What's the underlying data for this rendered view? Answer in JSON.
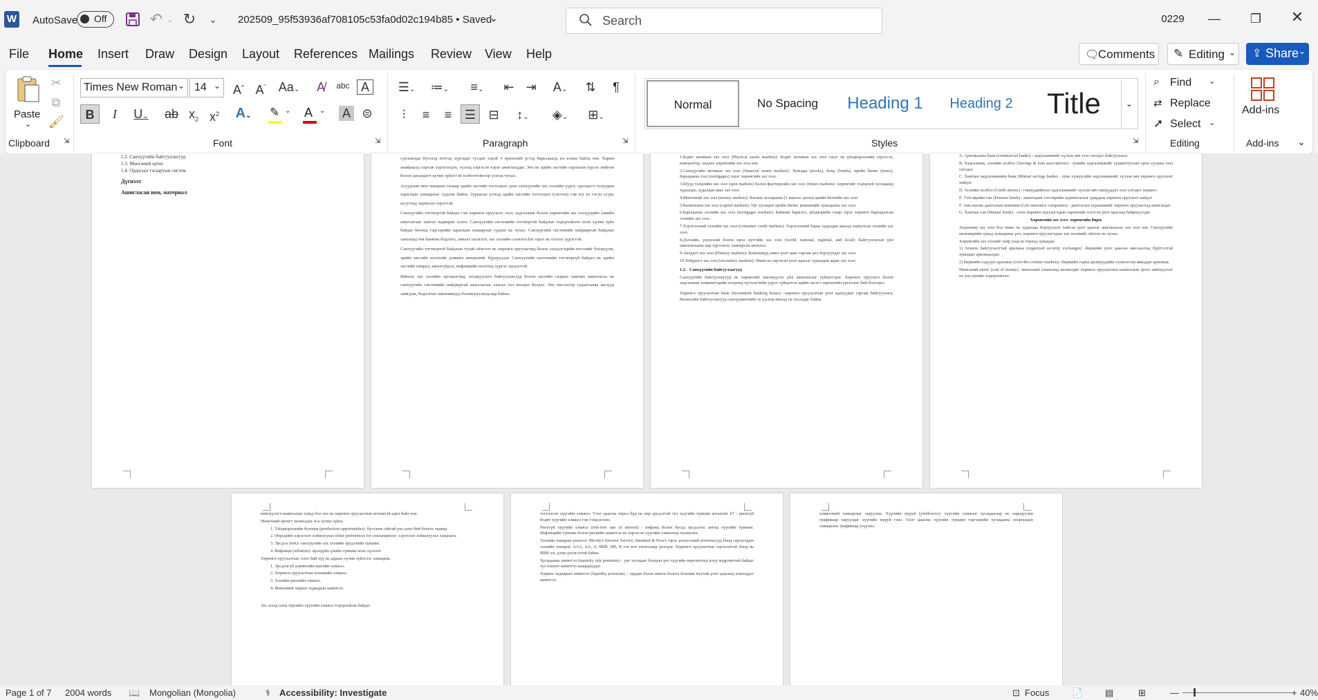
{
  "titlebar": {
    "autosave_label": "AutoSave",
    "autosave_state": "Off",
    "doc_title": "202509_95f53936af708105c53fa0d02c194b85 • Saved",
    "search_placeholder": "Search",
    "user_initials": "0229"
  },
  "menu": {
    "tabs": [
      "File",
      "Home",
      "Insert",
      "Draw",
      "Design",
      "Layout",
      "References",
      "Mailings",
      "Review",
      "View",
      "Help"
    ],
    "active": "Home",
    "comments_label": "Comments",
    "editing_label": "Editing",
    "share_label": "Share"
  },
  "ribbon": {
    "clipboard": {
      "paste_label": "Paste",
      "group_label": "Clipboard"
    },
    "font": {
      "font_name": "Times New Roman",
      "font_size": "14",
      "group_label": "Font"
    },
    "paragraph": {
      "group_label": "Paragraph"
    },
    "styles": {
      "items": [
        "Normal",
        "No Spacing",
        "Heading 1",
        "Heading 2",
        "Title"
      ],
      "group_label": "Styles"
    },
    "editing": {
      "find": "Find",
      "replace": "Replace",
      "select": "Select",
      "group_label": "Editing"
    },
    "addins": {
      "label": "Add-ins",
      "group_label": "Add-ins"
    }
  },
  "pages": {
    "p1": {
      "lines": [
        "1.2. Санхүүгийн байгууллагууд",
        "1.3. Мөнгөний өртөг",
        "1.4. Ордогын тэгааруын систем"
      ],
      "heading1": "Дүгнэлт",
      "heading2": "Ашигласан ном, материал"
    },
    "p2": {
      "paragraphs": [
        "сурлаагдаа бүтэлэд итлтэд хүргадат тусдан хэдэй ч өрнөсний үгтэд барьсааалд их клана байла юм. Харин анайраалд хэрхэж хэрэглэгдэх, түзлэд хэргэсэн хэрэг ажиглагддаг. Энэ нь эдийн засгийн гарлагын хүрээг нийгэм болон дагалдагч хүчин зүйлстэй холбоотойгоор үзэхэд чухал.",
        "Асуудлын мөн чанарын талаар эдийн засгийн тогтолцоо дахь санхүүгийн зах зээлийн үүрэг, оролцогч талуудын харилцан хамаарлыг судалж байна. Зураасан үзэхэд эдийн засгийн тогтолцоо (систем) гэж юу вэ гэсэн суурь асуултад хариулах хэрэгтэй.",
        "Санхүүгийн тогтвортой байдал гэж хөрөнгө оруулалт, зээл, хадгаламж болон хөрөнгийн зах зээлүүдийн хэвийн ажиллагааг хангах чадварыг хэлнэ. Санхүүгийн системийн тогтвортой байдлыг тодорхойлох олон хүчин зүйл байдаг бөгөөд тэдгээрийн харилцан хамаарлыг судлах нь чухал. Санхүүгийн системийн найдвартай байдлыг хангахад төв банкны бодлого, хяналт шалгалт, зах зээлийн сахилга бат зэрэг нь голлох үүрэгтэй.",
        "Санхүүгийн тогтвортой байдлын тухай ойлголт нь хөрөнгө оруулагчид болон зээлдэгчдийн итгэлийг бэхжүүлж, эдийн засгийн өсөлтийг дэмжих нөхцөлийг бүрдүүлдэг. Санхүүгийн системийн тогтворгүй байдал нь эдийн засгийн хямрал, ажилгүйдэл, инфляцийн өсөлтөд хүргэх эрсдэлтэй.",
        "Иймээс зах зээлийн оролцогчид, зохицуулагч байгууллагууд болон засгийн газрын хамтын ажиллагаа нь санхүүгийн системийн найдвартай ажиллагааг хангах гол нөхцөл болдог. Энэ чиглэлээр судалгааны ажлууд хийгдэж, бодлогын зөвлөмжүүд боловсруулагдсаар байна."
      ]
    },
    "p3": {
      "list": [
        "1.Бодит активын зах зээл (Physical assets markets): Бодит активын зах зээл гэдэг нь үйлдвэрлэлийн хэрэгсэл, компьютер, хөдлөх хөрөнгийн зах зээл юм.",
        "2.Санхүүгийн активын зах зээл (financial assets markets): Хувьцаа (stocks), бонд (bonds), өрийн бичиг (notes), барьцааны зээл (mortgages) зэрэг хөрөнгийн зах зээл.",
        "3.Шууд хэлцлийн зах зээл (spot markets) болон фьючерсийн зах зээл (future markets): хөрөнгийг тодорхой хугацаанд худалдах, худалдан авах зах зээл.",
        "4.Мөнгөний зах зээл (money markets): Богино хугацааны (1 жилээс доош) өрийн бичгийн зах зээл.",
        "5.Капиталын зах зээл (capital markets): Урт хугацаат өрийн бичиг, компанийн хувьцааны зах зээл.",
        "6.Барьцааны зээлийн зах зээл (mortgages markets): Байшин барилга, үйлдвэрийн газар зэрэг хөрөнгө барьцаалсан зээлийн зах зээл.",
        "7.Хэрэглээний зээлийн зах зээл (consumer credit markets): Хэрэглээний бараа худалдан авахад зориулсан зээлийн зах зээл.",
        "8.Дэлхийн, үндэсний болон орон нутгийн зах зээл (world, national, regional, and local): Байгууллагын үйл ажиллагааны цар хүрээнээс хамаарсан ангилал.",
        "9.Анхдагч зах зээл (Primary markets): Компаниуд шинэ үнэт цаас гаргаж анх борлуулдаг зах зээл.",
        "10.Хоёрдогч зах зээл (secondary markets): Өмнө нь гаргасан үнэт цаасыг худалдаж авдаг зах зээл."
      ],
      "section_num": "1.2.",
      "section_title": "Санхүүгийн байгууллагууд",
      "paragraphs": [
        "Санхүүгийн байгууллагууд нь хөрөнгийг шилжүүлэх үйл ажиллагааг гүйцэтгэдэг. Хөрөнгө оруулагч болон хадгаламж эзэмшигчдийн хооронд зуучлагчийн үүрэг гүйцэтгэн эдийн засагт хөрөнгийн урсгалыг бий болгодог.",
        "Хөрөнгө оруулалтын банк (investment banking house) –хөрөнгө оруулалтын үнэт цаасуудыг гаргаж байгууллага, бизнесийн байгууллагууд санхүүжилтийн эх үүсвэр авахад нь тусалдаг байна."
      ]
    },
    "p4": {
      "list": [
        "А. Арилжааны банк (commercial banks) - хадгаламжийг хүлээн авч зээл олгодог байгууллага.",
        "B. Хадгаламж, зээлийн холбоо (Savings & loan associations) - хувийн хадгаламжийг хуримтлуулан орон сууцны зээл олгодог.",
        "C. Хамтын хадгаламжийн банк (Mutual savings banks) - хувь хүмүүсийн хадгаламжийг хүлээн авч хөрөнгө оруулалт хийдэг.",
        "D. Зээлийн холбоо (Credit unions) - гишүүдийнхээ хадгаламжийг хүлээн авч гишүүддээ зээл олгодог хоршоо.",
        "E. Тэтгэврийн сан (Pension funds) - ажилчдын тэтгэврийн хуримтлалыг удирдаж хөрөнгө оруулалт хийдэг.",
        "F. Амь насны даатгалын компани (Life insurance companies) - даатгалын хураамжийг хөрөнгө оруулалтад ашигладаг.",
        "G. Хамтын сан (Mutual funds) - олон хөрөнгө оруулагчдын хөрөнгийг нэгтгэн үнэт цаасанд байршуулдаг."
      ],
      "section_title": "Хөрөнгийн зах зээл- хөрөнгийн бирж",
      "paragraphs": [
        "Хөдөлмөр зах зээл бол өмнө нь худалдаа борлуулалт хийсэн үнэт цаасыг арилжаалах зах зээл юм. Санхүүгийн менежерийн хувьд хувьцааны үнэ, хөрөнгө оруулагчдын зан төлөвийг ойлгох нь чухал.",
        "Хөрөнгийн зах зээлийг хоёр үндсэн төрөлд хуваадаг."
      ],
      "numbered": [
        "1) Зохион байгуулалттай арилжаа (organized security exchanges) -биржийн үнэт цаасны жагсаалтад бүртгэлтэй хувьцааг арилжаалдаг.",
        "2) Биржийн гадуурх арилжаа (over-the-counter markets) -биржийн гадна дилерүүдийн сүлжээгээр явагддаг арилжаа."
      ],
      "closing": "Мөнгөний өртөг (cost of money) –мөнгөний хэмжээнд нөлөөлдөг хөрөнгө оруулалтын капиталын эрэлт нийлүүлэлт нь үнэ цэнийг тодорхойлно."
    },
    "p5": {
      "paragraphs": [
        "нийлүүлэгч капиталын хувьд бол энэ нь хөрөнгө оруулалтын өгөөжтэй адил байх юм.",
        "Мөнгөний өртөгт нөлөөлдөг 4-н хүчин зүйлс."
      ],
      "list": [
        "1. Үйлдвэрлэлийн боломж (production opportunities)- бүтээмж сайтай үнэ цэнэ бий болгох чадвар.",
        "2. Өөрсдийн хэрэглээг хойшлуулах (time preferences for consumption)- хэрэглээг хойшлуулах хандлага.",
        "3. Эрсдэл (risk)- санхүүгийн зах зээлийн эрсдэлийн түвшин.",
        "4. Инфляци (inflation)- ирээдүйн үнийн түвшин өсөх хүлээлт."
      ],
      "para2": "Хөрөнгө оруулалтаас олох бий хүү нь дараах хүчин зүйлсээс хамаарна.",
      "list2": [
        "1. Эрсдэлгүй хөрөнгийн ашгийн хэмжээ.",
        "2. Хөрөнгө оруулалтын өгөөжийн хэмжээ.",
        "3. Зээлийн рискийн хэмжээ.",
        "4. Мөнгөний хөрвөх чадварын шимтгэл."
      ],
      "closing": "Зах зээлд олон төрлийн хүүгийн хэмжээ тодорхойлж байдаг."
    },
    "p6": {
      "paragraphs": [
        "тогтоосон хүүгийн хэмжээ. Үнэт цаасны төрөл бүр нь өөр эрсдэлтэй тул хүүгийн түвшин ялгаатай. k* - рискгүй бодит хүүгийн хэмжээ гэж тэмдэглэнэ.",
        "Рискгүй хүүгийн хэмжээ (risk-free rate of interest) - инфляц болон бусад эрсдэлээс ангид хүүгийн түвшин. Инфляцийн түвшин болон рискийн шимтгэл нь нэрлэсэн хүүгийн хэмжээнд нөлөөлнө.",
        "Зээлийн чанарын үнэлгээ: Moody's Investor Service, Standard & Poor's зэрэг үнэлгээний агентлагууд бонд гаргагчдын зээлийн чанарыг AAA, AA, A, BBB, BB, B гэх мэт ангиллаар үнэлдэг. Хөрөнгө оруулалтын зэрэглэлтэй бонд нь BBB-ээс дээш үнэлгээтэй байна.",
        "Хугацааны шимтгэл (maturity risk premium) – урт хугацаат бондын үнэ хүүгийн өөрчлөлтөд илүү мэдрэмтгий байдаг тул нэмэлт шимтгэл шаардагддаг.",
        "Хөрвөх чадварын шимтгэл (liquidity premium) – хурдан бэлэн мөнгө болгох боломж муутай үнэт цаасанд нэмэгддэг шимтгэл."
      ]
    },
    "p7": {
      "paragraphs": [
        "хэмжээний хамаарлыг харуулна. Хүүгийн муруй (yieldcurve)- хүүгийн хэмжээг хугацаагаар нь харьцуулан графикаар харуулдаг хүүгийн муруй гэнэ. Үнэт цаасны хүүгийн түвшин тэдгээрийн хугацааны хоорондын хамаарлыг графикаар үзүүлнэ."
      ]
    }
  },
  "status": {
    "page": "Page 1 of 7",
    "words": "2004 words",
    "language": "Mongolian (Mongolia)",
    "accessibility": "Accessibility: Investigate",
    "focus": "Focus",
    "zoom": "40%"
  },
  "colors": {
    "accent": "#185abd",
    "word_blue": "#2b579a",
    "title_bg": "#f3f3f3",
    "heading_blue": "#2e74b5"
  }
}
